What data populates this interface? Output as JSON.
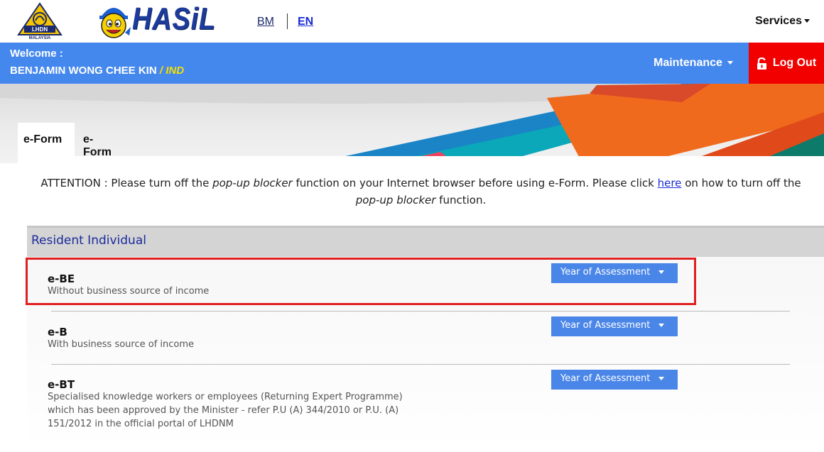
{
  "header": {
    "logo_text": "LHDN MALAYSIA",
    "brand": "HASiL",
    "lang_bm": "BM",
    "lang_en": "EN",
    "services_label": "Services"
  },
  "userbar": {
    "welcome_label": "Welcome :",
    "user_name": "BENJAMIN WONG CHEE KIN",
    "user_type": "/ IND",
    "maintenance_label": "Maintenance",
    "logout_label": "Log Out"
  },
  "tabs": [
    {
      "label": "e-Form",
      "active": true
    },
    {
      "label": "e-Form Status",
      "active": false
    }
  ],
  "attention": {
    "prefix": "ATTENTION : Please turn off the ",
    "em1": "pop-up blocker",
    "mid": " function on your Internet browser before using e-Form. Please click ",
    "link": "here",
    "after_link": " on how to turn off the ",
    "em2": "pop-up blocker",
    "suffix": " function."
  },
  "section": {
    "title": "Resident Individual"
  },
  "forms": [
    {
      "name": "e-BE",
      "desc": "Without business source of income",
      "button": "Year of Assessment",
      "highlighted": true
    },
    {
      "name": "e-B",
      "desc": "With business source of income",
      "button": "Year of Assessment",
      "highlighted": false
    },
    {
      "name": "e-BT",
      "desc_lines": [
        "Specialised knowledge workers or employees (Returning Expert Programme)",
        "which has been approved by the Minister - refer P.U (A) 344/2010 or P.U. (A)",
        "151/2012 in the official portal of LHDNM"
      ],
      "button": "Year of Assessment",
      "highlighted": false
    }
  ],
  "colors": {
    "blue_bar": "#4488ee",
    "logout_red": "#f20000",
    "button_blue": "#4a86e8",
    "highlight_red": "#e02020",
    "section_title": "#1a2a9a",
    "user_type_yellow": "#f5e000"
  }
}
